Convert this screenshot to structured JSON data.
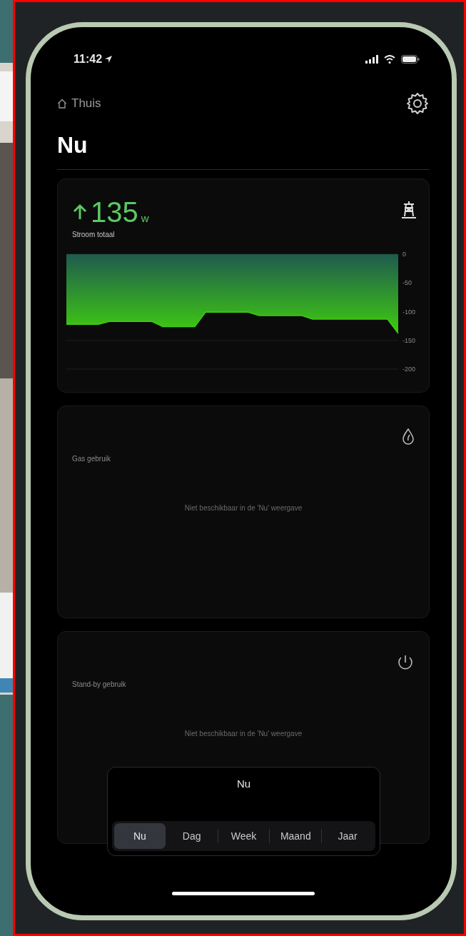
{
  "status_bar": {
    "time": "11:42"
  },
  "header": {
    "back_label": "Thuis"
  },
  "title": "Nu",
  "power_card": {
    "rising": true,
    "value": "135",
    "unit": "w",
    "label": "Stroom totaal",
    "chart_data": {
      "type": "area",
      "ylim": [
        -200,
        0
      ],
      "yticks": [
        0,
        -50,
        -100,
        -150,
        -200
      ],
      "values": [
        -122,
        -122,
        -122,
        -122,
        -117,
        -117,
        -117,
        -117,
        -117,
        -126,
        -126,
        -126,
        -126,
        -101,
        -101,
        -101,
        -101,
        -101,
        -107,
        -107,
        -107,
        -107,
        -107,
        -113,
        -113,
        -113,
        -113,
        -113,
        -113,
        -113,
        -113,
        -138
      ]
    }
  },
  "cards": [
    {
      "kind": "gas",
      "label": "Gas gebruik",
      "message": "Niet beschikbaar in de 'Nu' weergave"
    },
    {
      "kind": "standby",
      "label": "Stand-by gebruik",
      "message": "Niet beschikbaar in de 'Nu' weergave"
    }
  ],
  "period_picker": {
    "title": "Nu",
    "tabs": [
      {
        "label": "Nu",
        "selected": true
      },
      {
        "label": "Dag",
        "selected": false
      },
      {
        "label": "Week",
        "selected": false
      },
      {
        "label": "Maand",
        "selected": false
      },
      {
        "label": "Jaar",
        "selected": false
      }
    ]
  }
}
